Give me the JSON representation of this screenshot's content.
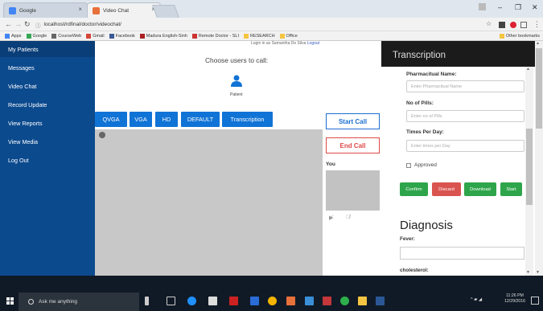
{
  "browser": {
    "tabs": [
      {
        "label": "Google",
        "color": "#4285f4"
      },
      {
        "label": "Video Chat",
        "color": "#e8703a"
      }
    ],
    "url": "localhost/rdfinal/doctor/videochat/",
    "bookmarks": [
      "Apps",
      "Google",
      "CourseWeb",
      "Gmail",
      "Facebook",
      "Madura English-Sinh",
      "Remote Doctor - SLI",
      "RESEARCH",
      "Office"
    ],
    "other_bookmarks": "Other bookmarks"
  },
  "sidebar": {
    "items": [
      "My Patients",
      "Messages",
      "Video Chat",
      "Record Update",
      "View Reports",
      "View Media",
      "Log Out"
    ]
  },
  "main": {
    "logged_in_text": "Login in as Samantha De Silva",
    "logout_label": "Logout",
    "choose_title": "Choose users to call:",
    "patient_label": "Patient",
    "res_buttons": [
      "QVGA",
      "VGA",
      "HD",
      "DEFAULT",
      "Transcription"
    ],
    "start_call": "Start Call",
    "end_call": "End Call",
    "you_label": "You"
  },
  "transcription": {
    "title": "Transcription",
    "fields": [
      {
        "label": "Pharmacitual Name:",
        "placeholder": "Enter Pharmacitual Name"
      },
      {
        "label": "No of Pills:",
        "placeholder": "Enter no of Pills"
      },
      {
        "label": "Times Per Day:",
        "placeholder": "Enter times per Day"
      }
    ],
    "approved_label": "Approved",
    "buttons": [
      "Confirm",
      "Discard",
      "Download",
      "Start"
    ],
    "button_colors": [
      "#2ea54a",
      "#d9534f",
      "#2ea54a",
      "#2ea54a"
    ],
    "diagnosis_title": "Diagnosis",
    "diagnosis_fields": [
      "Fever:",
      "cholesterol:"
    ]
  },
  "taskbar": {
    "search_placeholder": "Ask me anything",
    "time": "11:26 PM",
    "date": "12/29/2016"
  },
  "colors": {
    "sidebar": "#0c4a8e",
    "accent": "#1073d6",
    "end_call": "#e04848"
  }
}
